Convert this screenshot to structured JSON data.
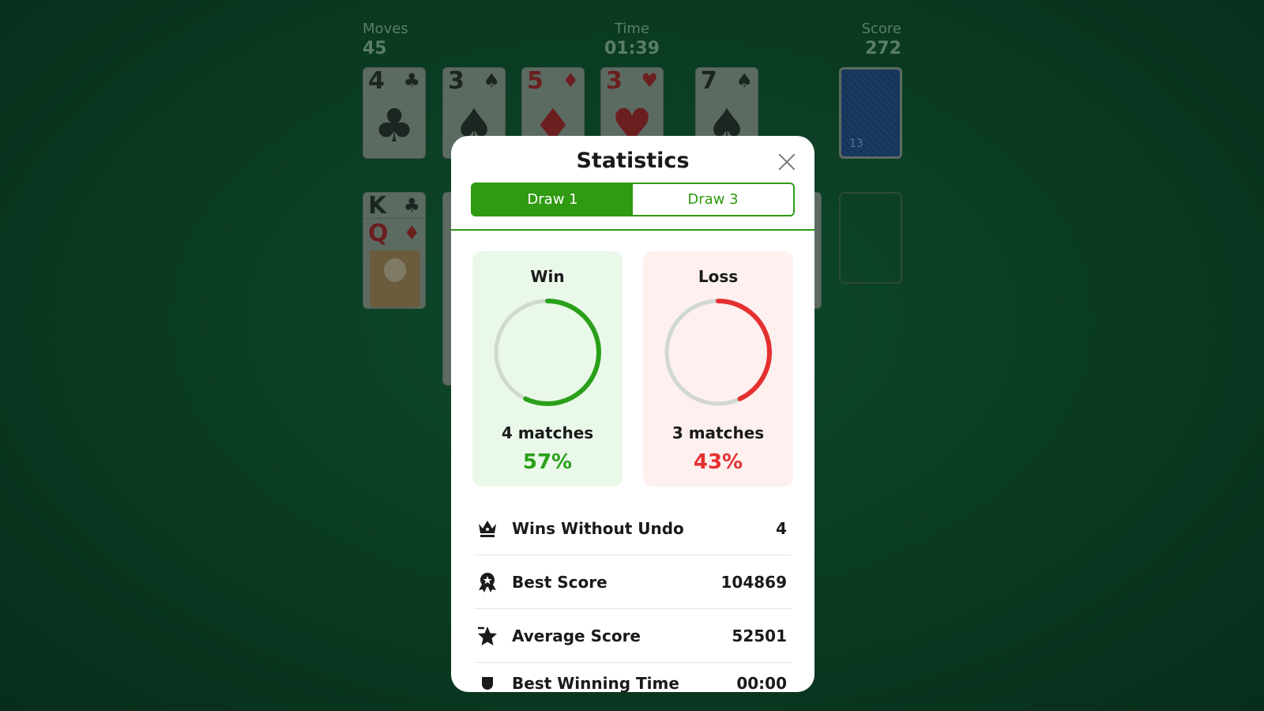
{
  "hud": {
    "moves_label": "Moves",
    "moves_value": "45",
    "time_label": "Time",
    "time_value": "01:39",
    "score_label": "Score",
    "score_value": "272"
  },
  "foundation_cards": [
    {
      "rank": "4",
      "suit": "♣",
      "color": "black"
    },
    {
      "rank": "3",
      "suit": "♠",
      "color": "black"
    },
    {
      "rank": "5",
      "suit": "♦",
      "color": "red"
    },
    {
      "rank": "3",
      "suit": "♥",
      "color": "red"
    },
    {
      "rank": "7",
      "suit": "♠",
      "color": "black"
    }
  ],
  "stock": {
    "count": "13"
  },
  "tableau_cards": [
    {
      "rank": "K",
      "suit": "♣"
    },
    {
      "rank": "Q",
      "suit": "♦"
    }
  ],
  "dialog": {
    "title": "Statistics",
    "close_icon": "close-icon",
    "tabs": [
      {
        "label": "Draw 1",
        "active": true
      },
      {
        "label": "Draw 3",
        "active": false
      }
    ],
    "win": {
      "heading": "Win",
      "matches": "4 matches",
      "percent": "57%",
      "fraction": 0.57,
      "color": "#2aa01a"
    },
    "loss": {
      "heading": "Loss",
      "matches": "3 matches",
      "percent": "43%",
      "fraction": 0.43,
      "color": "#e53030"
    },
    "rows": [
      {
        "icon": "crown-icon",
        "label": "Wins Without Undo",
        "value": "4"
      },
      {
        "icon": "medal-icon",
        "label": "Best Score",
        "value": "104869"
      },
      {
        "icon": "star-icon",
        "label": "Average Score",
        "value": "52501"
      },
      {
        "icon": "trophy-icon",
        "label": "Best Winning Time",
        "value": "00:00"
      }
    ]
  },
  "colors": {
    "accent_green": "#2f9a12",
    "ring_track": "#d0d8d0"
  }
}
